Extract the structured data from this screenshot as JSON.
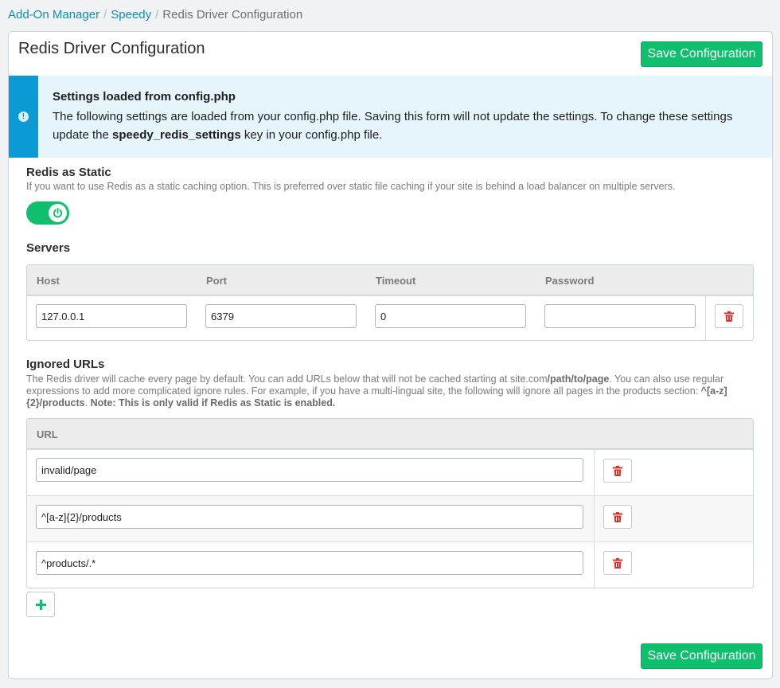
{
  "breadcrumb": {
    "items": [
      "Add-On Manager",
      "Speedy"
    ],
    "current": "Redis Driver Configuration",
    "separator": "/"
  },
  "panel": {
    "title": "Redis Driver Configuration",
    "save_label": "Save Configuration"
  },
  "alert": {
    "title": "Settings loaded from config.php",
    "text_1": "The following settings are loaded from your config.php file. Saving this form will not update the settings. To change these settings update the ",
    "key": "speedy_redis_settings",
    "text_2": " key in your config.php file."
  },
  "static": {
    "label": "Redis as Static",
    "description": "If you want to use Redis as a static caching option. This is preferred over static file caching if your site is behind a load balancer on multiple servers.",
    "enabled": true
  },
  "servers": {
    "label": "Servers",
    "columns": [
      "Host",
      "Port",
      "Timeout",
      "Password"
    ],
    "rows": [
      {
        "host": "127.0.0.1",
        "port": "6379",
        "timeout": "0",
        "password": ""
      }
    ]
  },
  "ignored": {
    "label": "Ignored URLs",
    "desc_1": "The Redis driver will cache every page by default. You can add URLs below that will not be cached starting at site.com",
    "desc_path": "/path/to/page",
    "desc_2": ". You can also use regular expressions to add more complicated ignore rules. For example, if you have a multi-lingual site, the following will ignore all pages in the products section: ",
    "desc_example": "^[a-z]{2}/products",
    "desc_3": ". ",
    "desc_note": "Note: This is only valid if Redis as Static is enabled.",
    "column": "URL",
    "rows": [
      "invalid/page",
      "^[a-z]{2}/products",
      "^products/.*"
    ]
  },
  "colors": {
    "accent_green": "#0fbf6e",
    "link_blue": "#0b8fb0",
    "alert_blue": "#0b9ad3",
    "danger_red": "#e03131"
  }
}
